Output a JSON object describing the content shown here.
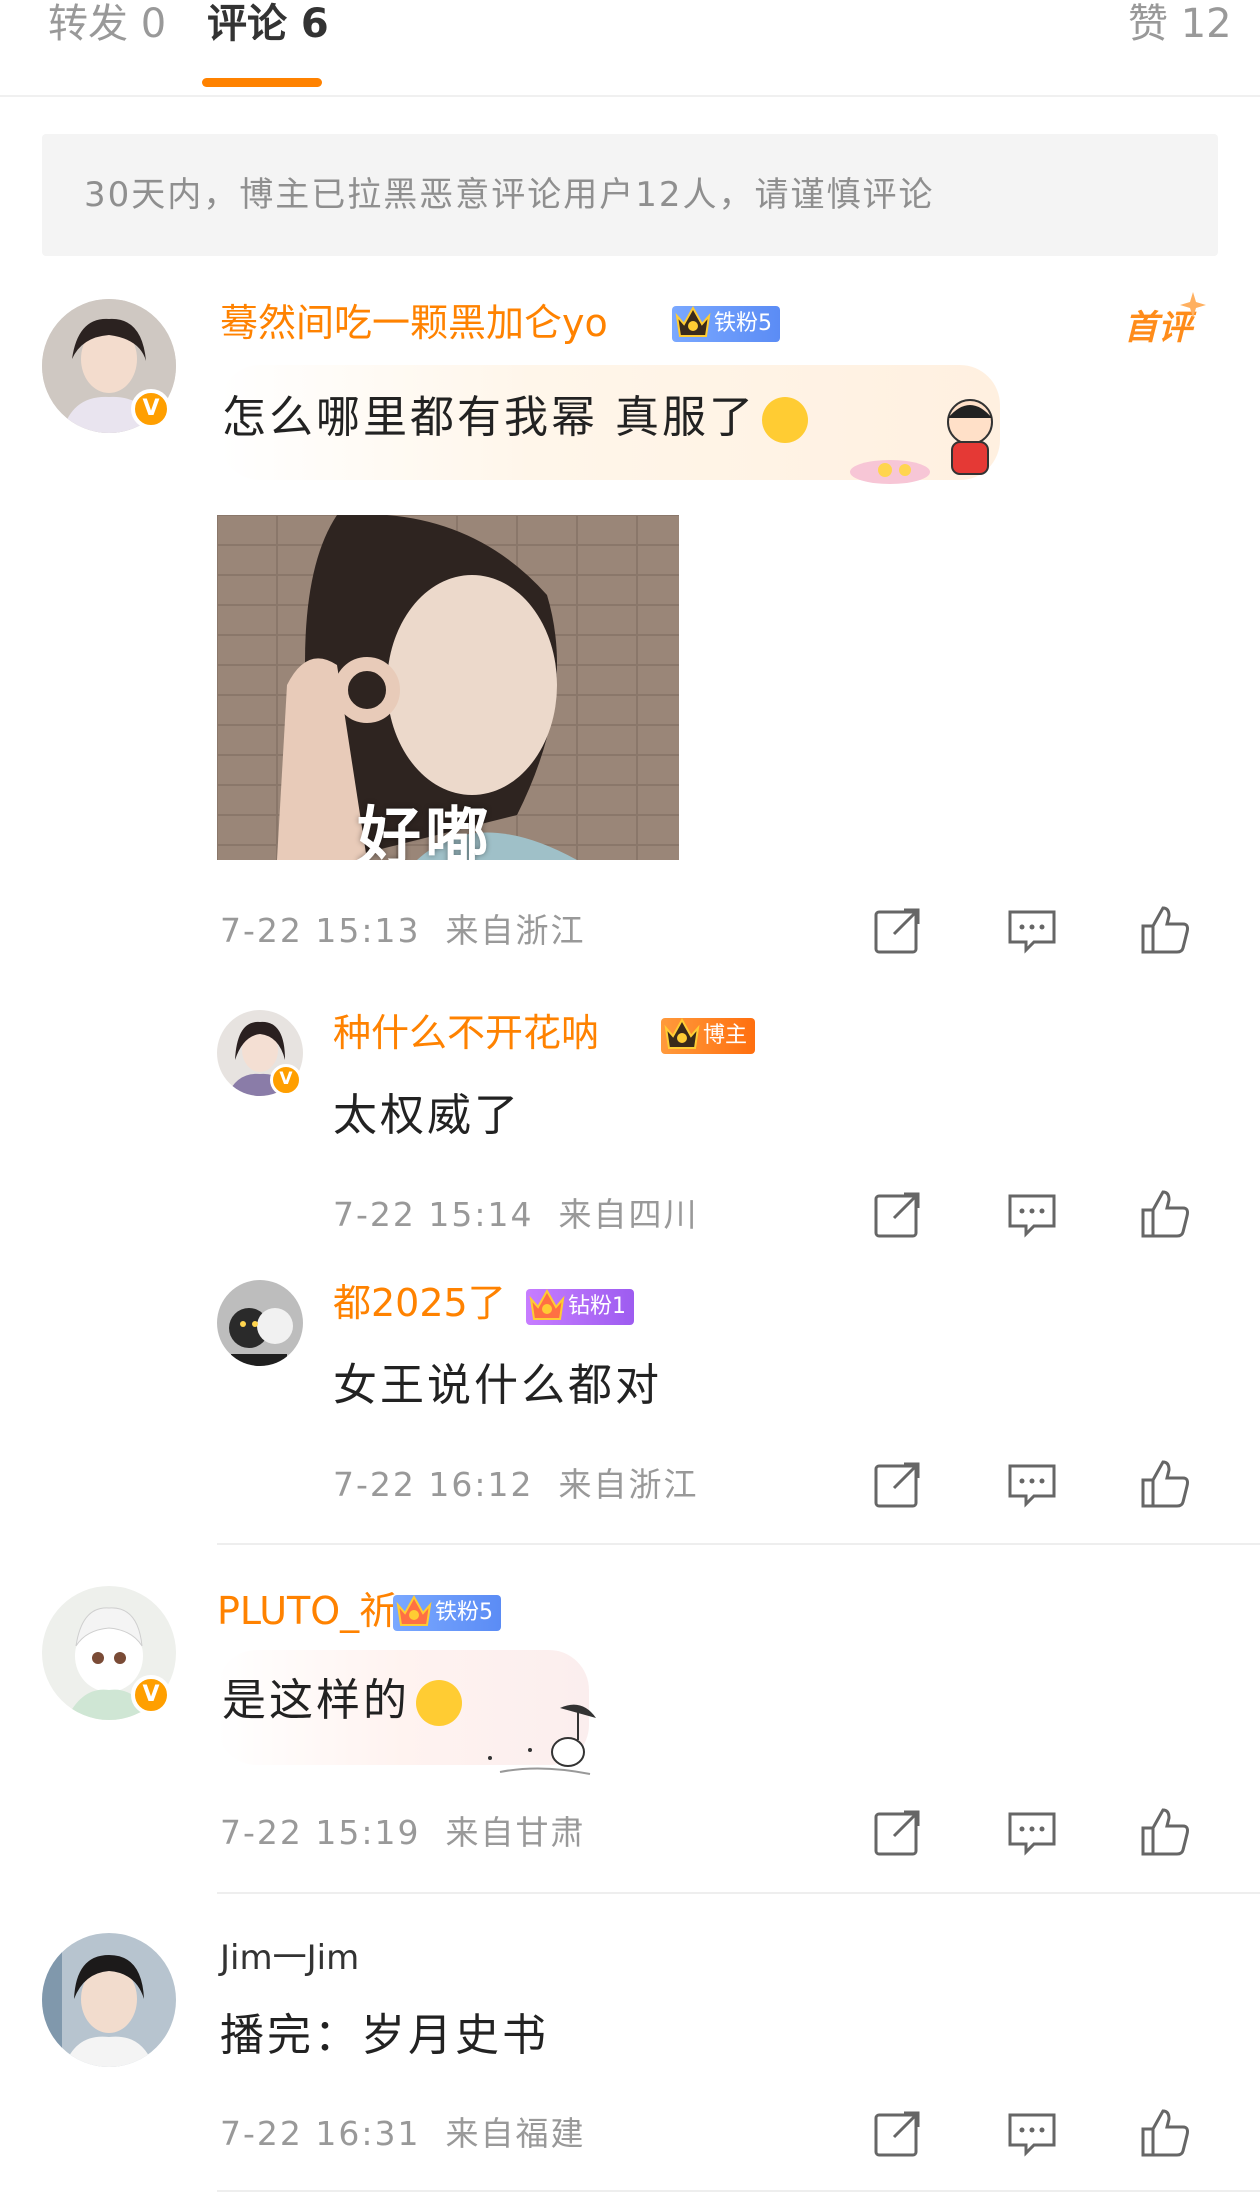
{
  "tabs": {
    "reposts": "转发 0",
    "comments": "评论 6",
    "likes": "赞 12"
  },
  "notice": "30天内，博主已拉黑恶意评论用户12人，请谨慎评论",
  "comments": [
    {
      "user": "蓦然间吃一颗黑加仑yo",
      "badge": "铁粉5",
      "first_tag": "首评",
      "text": "怎么哪里都有我幂 真服了",
      "photo_caption": "好嘟",
      "time": "7-22 15:13",
      "location": "来自浙江",
      "replies": [
        {
          "user": "种什么不开花呐",
          "badge": "博主",
          "text": "太权威了",
          "time": "7-22 15:14",
          "location": "来自四川"
        },
        {
          "user": "都2025了",
          "badge": "钻粉1",
          "text": "女王说什么都对",
          "time": "7-22 16:12",
          "location": "来自浙江"
        }
      ]
    },
    {
      "user": "PLUTO_祈",
      "badge": "铁粉5",
      "text": "是这样的",
      "time": "7-22 15:19",
      "location": "来自甘肃"
    },
    {
      "user": "Jim一Jim",
      "text": "播完：岁月史书",
      "time": "7-22 16:31",
      "location": "来自福建"
    }
  ],
  "icons": [
    "share-icon",
    "comment-icon",
    "like-icon",
    "verified-icon",
    "crown-icon"
  ],
  "colors": {
    "accent": "#ff8200",
    "username": "#ff8200",
    "meta": "#999999",
    "notice_bg": "#f4f4f4"
  }
}
